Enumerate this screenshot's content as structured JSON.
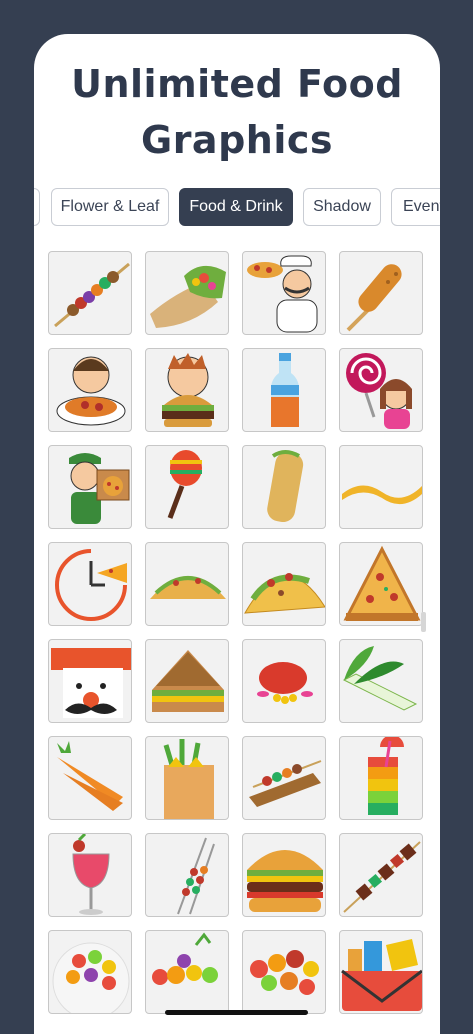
{
  "header": {
    "title_line1": "Unlimited Food",
    "title_line2": "Graphics"
  },
  "tabs": [
    {
      "label": "",
      "active": false
    },
    {
      "label": "Flower & Leaf",
      "active": false
    },
    {
      "label": "Food & Drink",
      "active": true
    },
    {
      "label": "Shadow",
      "active": false
    },
    {
      "label": "Events",
      "active": false
    }
  ],
  "graphics": [
    "kebab-skewer",
    "burrito-wrap",
    "chef-with-pizza",
    "corn-dog",
    "boy-eating-spaghetti",
    "boy-eating-burger",
    "soda-bottle",
    "girl-with-lollipop",
    "pizza-delivery-boy",
    "maraca",
    "burrito",
    "cheese-stretch",
    "clock-pizza",
    "taco",
    "taco-loaded",
    "pizza-slice",
    "chef-mustache",
    "sandwich",
    "meat-dish",
    "leek",
    "carrots",
    "grocery-bag",
    "skewers-on-board",
    "rainbow-drink",
    "cocktail-glass",
    "two-skewers",
    "burger",
    "meat-skewer",
    "fruit-bowl",
    "fruit-pile",
    "fruit-assortment",
    "grocery-basket"
  ],
  "colors": {
    "accent": "#353f51",
    "title": "#2f394d",
    "tile_bg": "#f2f2f2"
  }
}
